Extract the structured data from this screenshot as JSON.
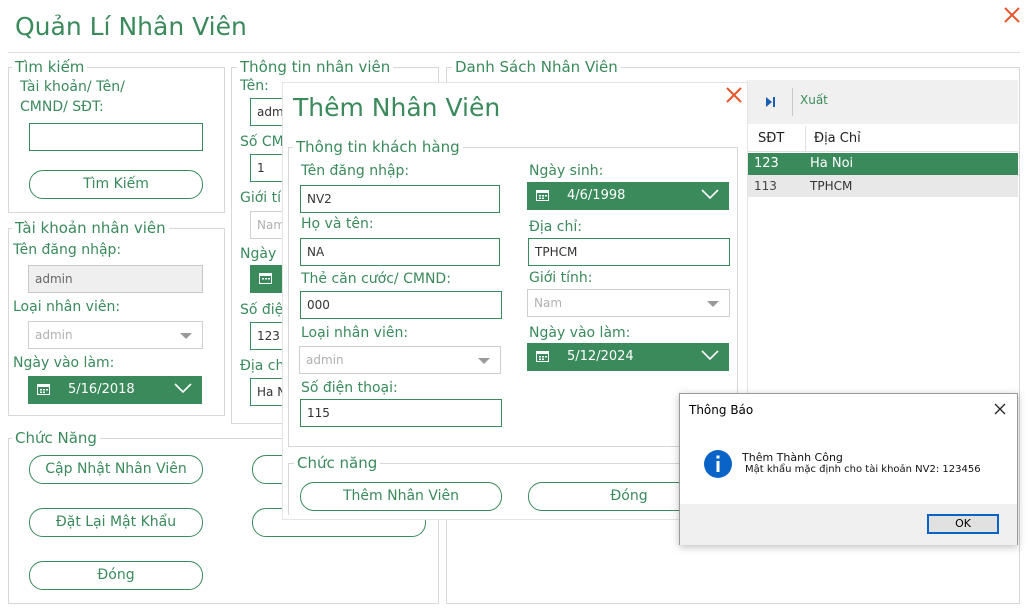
{
  "app": {
    "title": "Quản Lí Nhân Viên"
  },
  "search": {
    "group_title": "Tìm kiếm",
    "label": "Tài khoản/ Tên/\nCMND/ SĐT:",
    "value": "",
    "button": "Tìm Kiếm"
  },
  "account": {
    "group_title": "Tài khoản nhân viên",
    "username_label": "Tên đăng nhập:",
    "username_value": "admin",
    "type_label": "Loại nhân viên:",
    "type_value": "admin",
    "start_label": "Ngày vào làm:",
    "start_value": "5/16/2018"
  },
  "info": {
    "group_title": "Thông tin nhân viên",
    "name_label": "Tên:",
    "name_value": "adm",
    "id_label": "Số CM",
    "id_value": "1",
    "gender_label": "Giới tí",
    "gender_value": "Nam",
    "date_label": "Ngày",
    "phone_label": "Số điệ",
    "phone_value": "123",
    "address_label": "Địa ch",
    "address_value": "Ha N"
  },
  "functions": {
    "group_title": "Chức Năng",
    "update": "Cập Nhật Nhân Viên",
    "reset": "Đặt Lại Mật Khẩu",
    "close": "Đóng"
  },
  "list": {
    "group_title": "Danh Sách Nhân Viên",
    "export": "Xuất",
    "columns": [
      "SĐT",
      "Địa Chỉ"
    ],
    "rows": [
      {
        "phone": "123",
        "address": "Ha Noi"
      },
      {
        "phone": "113",
        "address": "TPHCM"
      }
    ]
  },
  "add_dialog": {
    "title": "Thêm Nhân Viên",
    "info_title": "Thông tin khách hàng",
    "username_label": "Tên đăng nhập:",
    "username_value": "NV2",
    "fullname_label": "Họ và tên:",
    "fullname_value": "NA",
    "id_label": "Thẻ căn cước/ CMND:",
    "id_value": "000",
    "type_label": "Loại nhân viên:",
    "type_value": "admin",
    "phone_label": "Số điện thoại:",
    "phone_value": "115",
    "dob_label": "Ngày sinh:",
    "dob_value": "4/6/1998",
    "address_label": "Địa chỉ:",
    "address_value": "TPHCM",
    "gender_label": "Giới tính:",
    "gender_value": "Nam",
    "start_label": "Ngày vào làm:",
    "start_value": "5/12/2024",
    "func_title": "Chức năng",
    "add_button": "Thêm Nhân Viên",
    "close_button": "Đóng"
  },
  "message_box": {
    "title": "Thông Báo",
    "line1": "Thêm Thành Công",
    "line2": "Mật khẩu mặc định cho tài khoản NV2: 123456",
    "ok": "OK"
  },
  "colors": {
    "accent": "#3a8a5c",
    "close": "#e8542b",
    "info_icon": "#0a64c8"
  }
}
